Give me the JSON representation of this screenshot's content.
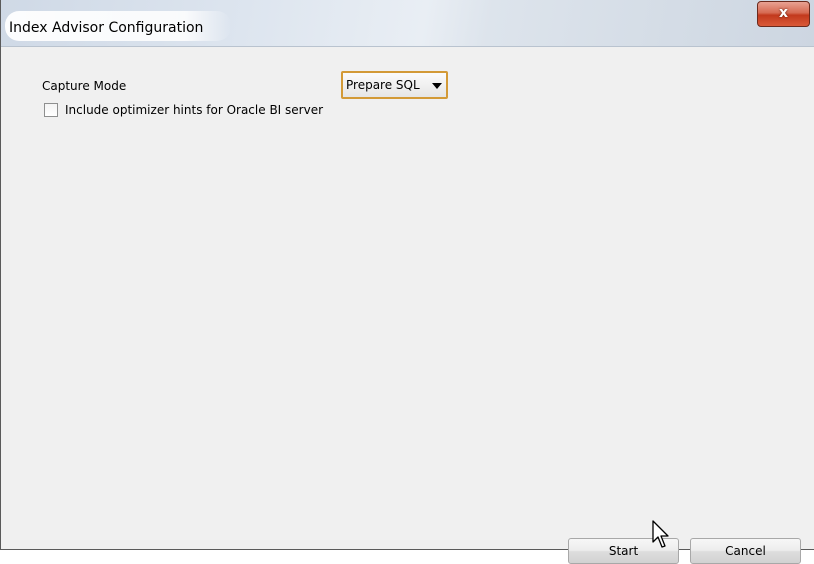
{
  "window": {
    "title": "Index Advisor Configuration",
    "close_glyph": "x"
  },
  "form": {
    "capture_mode_label": "Capture Mode",
    "capture_mode_value": "Prepare SQL",
    "include_hints_label": "Include optimizer hints for Oracle BI server",
    "include_hints_checked": false
  },
  "buttons": {
    "start_label": "Start",
    "cancel_label": "Cancel"
  },
  "colors": {
    "dialog_background": "#f0f0f0",
    "select_focus_border": "#d39a37",
    "close_button": "#c2391d"
  },
  "icons": {
    "close": "close-icon",
    "dropdown": "chevron-down-icon",
    "pointer": "mouse-pointer-icon"
  }
}
